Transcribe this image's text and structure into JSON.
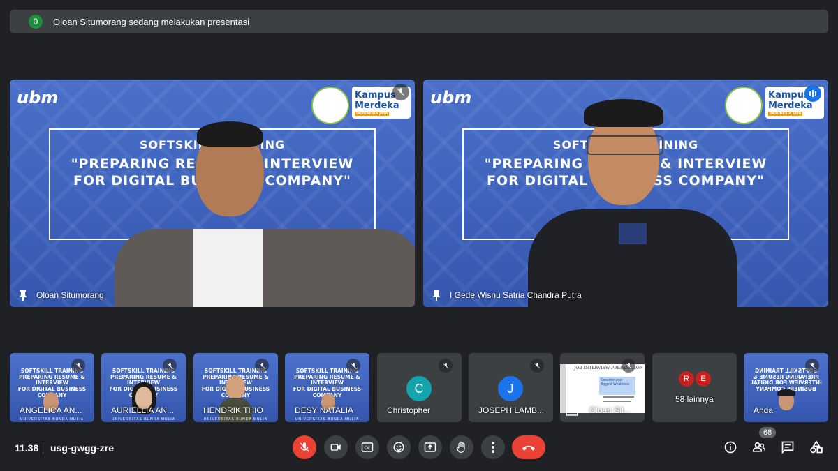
{
  "banner": {
    "count": "0",
    "text": "Oloan Situmorang sedang melakukan presentasi"
  },
  "main_tiles": [
    {
      "name": "Oloan Situmorang",
      "logo": "ubm",
      "slide_line1": "SOFTSKILL TRAINING",
      "slide_line2": "\"PREPARING RESUME & INTERVIEW",
      "slide_line3": "FOR DIGITAL BUSINESS COMPANY\"",
      "kampus_1": "Kampus",
      "kampus_2": "Merdeka",
      "kampus_3": "INDONESIA JAYA"
    },
    {
      "name": "I Gede Wisnu Satria Chandra Putra",
      "logo": "ubm",
      "slide_line1": "SOFTSKILL TRAINING",
      "slide_line2": "\"PREPARING RESUME & INTERVIEW",
      "slide_line3": "FOR DIGITAL BUSINESS COMPANY\"",
      "kampus_1": "Kampus",
      "kampus_2": "Merdeka",
      "kampus_3": "INDONESIA JAYA"
    }
  ],
  "thumbs": [
    {
      "name": "ANGELICA AN...",
      "title": "SOFTSKILL TRAINING\nPREPARING RESUME & INTERVIEW\nFOR DIGITAL BUSINESS COMPANY",
      "foot": "UNIVERSITAS BUNDA MULIA"
    },
    {
      "name": "AURIELLIA AN...",
      "title": "SOFTSKILL TRAINING\nPREPARING RESUME & INTERVIEW\nFOR DIGITAL BUSINESS COMPANY",
      "foot": "UNIVERSITAS BUNDA MULIA"
    },
    {
      "name": "HENDRIK THIO",
      "title": "SOFTSKILL TRAINING\nPREPARING RESUME & INTERVIEW\nFOR DIGITAL BUSINESS COMPANY",
      "foot": "UNIVERSITAS BUNDA MULIA"
    },
    {
      "name": "DESY NATALIA",
      "title": "SOFTSKILL TRAINING\nPREPARING RESUME & INTERVIEW\nFOR DIGITAL BUSINESS COMPANY",
      "foot": "UNIVERSITAS BUNDA MULIA"
    },
    {
      "name": "Christopher",
      "initial": "C",
      "color": "#12a4af"
    },
    {
      "name": "JOSEPH LAMB...",
      "initial": "J",
      "color": "#1a73e8"
    },
    {
      "name": "Oloan Sit...",
      "doc_title": "JOB INTERVIEW PREPARATION",
      "doc_box": "Consider your Biggest Weakness"
    },
    {
      "name": "58 lainnya",
      "avatar1": "R",
      "avatar2": "E",
      "avatar1_color": "#c5221f",
      "avatar2_color": "#c5221f"
    },
    {
      "name": "Anda"
    }
  ],
  "bottom": {
    "time": "11.38",
    "meeting_code": "usg-gwgg-zre",
    "participant_count": "68"
  },
  "colors": {
    "background": "#202124",
    "tile": "#3c4043",
    "red": "#ea4335",
    "speaking": "#1a73e8"
  }
}
